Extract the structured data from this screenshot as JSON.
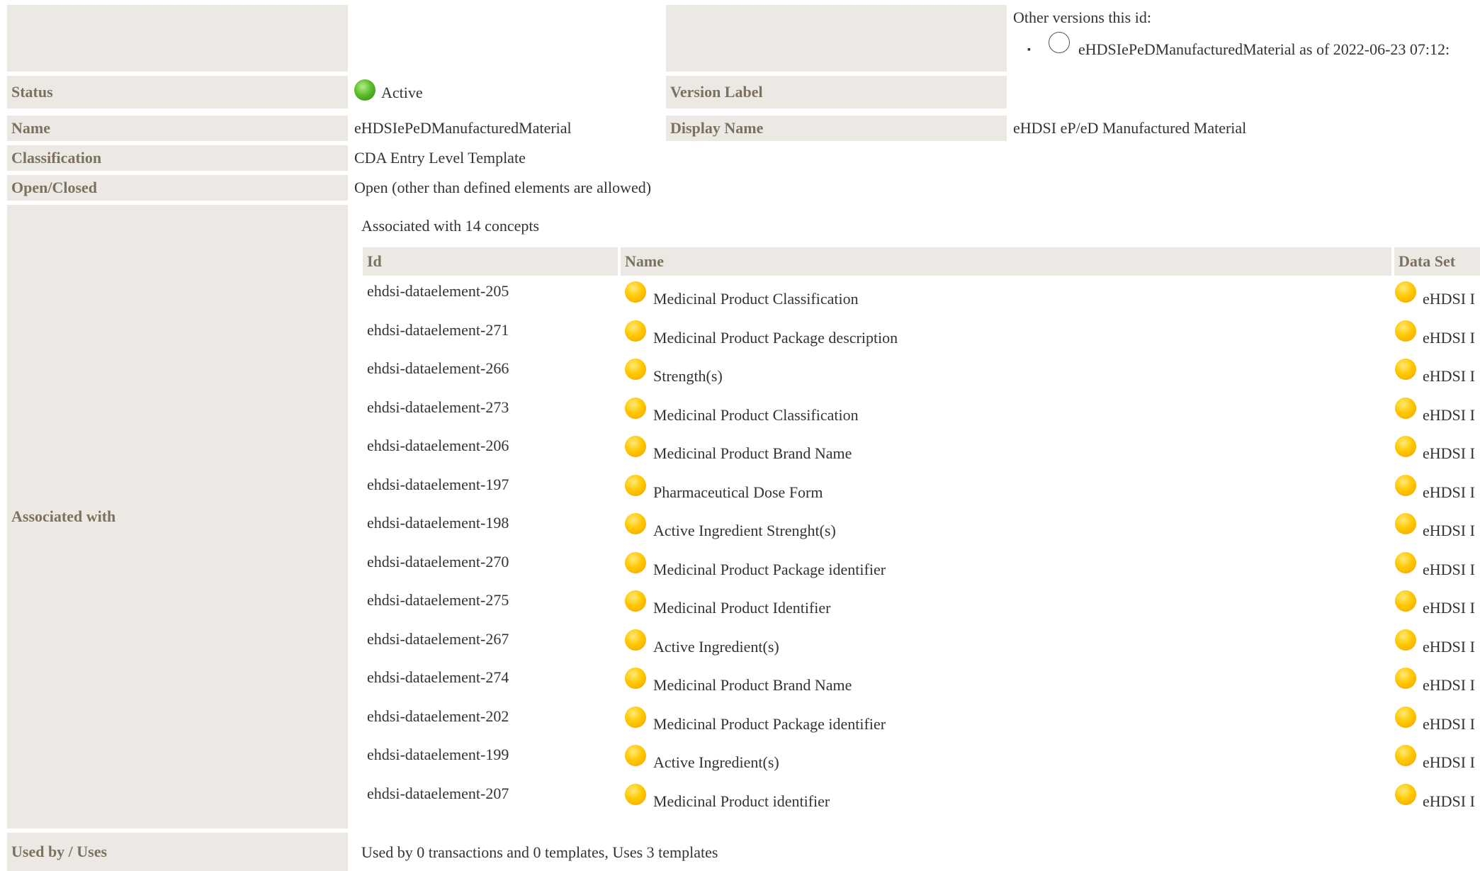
{
  "other_versions": {
    "heading": "Other versions this id:",
    "items": [
      {
        "text": "eHDSIePeDManufacturedMaterial as of 2022-06-23 07:12:"
      }
    ]
  },
  "fields": {
    "status_label": "Status",
    "status_value": "Active",
    "version_label_label": "Version Label",
    "name_label": "Name",
    "name_value": "eHDSIePeDManufacturedMaterial",
    "display_name_label": "Display Name",
    "display_name_value": "eHDSI eP/eD Manufactured Material",
    "classification_label": "Classification",
    "classification_value": "CDA Entry Level Template",
    "open_closed_label": "Open/Closed",
    "open_closed_value": "Open (other than defined elements are allowed)",
    "associated_label": "Associated with",
    "used_by_label": "Used by / Uses",
    "used_by_value": "Used by 0 transactions and 0 templates, Uses 3 templates"
  },
  "concepts": {
    "summary": "Associated with 14 concepts",
    "headers": {
      "id": "Id",
      "name": "Name",
      "dataset": "Data Set"
    },
    "rows": [
      {
        "id": "ehdsi-dataelement-205",
        "name": "Medicinal Product Classification",
        "dataset": "eHDSI I"
      },
      {
        "id": "ehdsi-dataelement-271",
        "name": "Medicinal Product Package description",
        "dataset": "eHDSI I"
      },
      {
        "id": "ehdsi-dataelement-266",
        "name": "Strength(s)",
        "dataset": "eHDSI I"
      },
      {
        "id": "ehdsi-dataelement-273",
        "name": "Medicinal Product Classification",
        "dataset": "eHDSI I"
      },
      {
        "id": "ehdsi-dataelement-206",
        "name": "Medicinal Product Brand Name",
        "dataset": "eHDSI I"
      },
      {
        "id": "ehdsi-dataelement-197",
        "name": "Pharmaceutical Dose Form",
        "dataset": "eHDSI I"
      },
      {
        "id": "ehdsi-dataelement-198",
        "name": "Active Ingredient Strenght(s)",
        "dataset": "eHDSI I"
      },
      {
        "id": "ehdsi-dataelement-270",
        "name": "Medicinal Product Package identifier",
        "dataset": "eHDSI I"
      },
      {
        "id": "ehdsi-dataelement-275",
        "name": "Medicinal Product Identifier",
        "dataset": "eHDSI I"
      },
      {
        "id": "ehdsi-dataelement-267",
        "name": "Active Ingredient(s)",
        "dataset": "eHDSI I"
      },
      {
        "id": "ehdsi-dataelement-274",
        "name": "Medicinal Product Brand Name",
        "dataset": "eHDSI I"
      },
      {
        "id": "ehdsi-dataelement-202",
        "name": "Medicinal Product Package identifier",
        "dataset": "eHDSI I"
      },
      {
        "id": "ehdsi-dataelement-199",
        "name": "Active Ingredient(s)",
        "dataset": "eHDSI I"
      },
      {
        "id": "ehdsi-dataelement-207",
        "name": "Medicinal Product identifier",
        "dataset": "eHDSI I"
      }
    ]
  },
  "colors": {
    "label_bg": "#ece9e4",
    "label_text": "#7c715f",
    "status_active": "#5cbc2a",
    "concept_dot": "#ffc800"
  },
  "icons": {
    "status": "green-dot-icon",
    "concept": "yellow-dot-icon",
    "version": "empty-circle-icon"
  }
}
